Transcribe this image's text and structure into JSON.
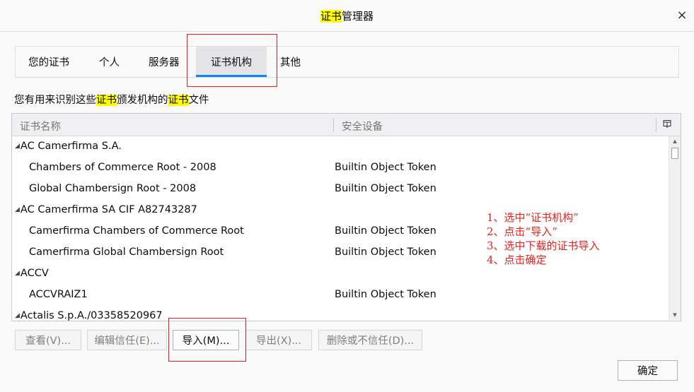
{
  "dialog": {
    "title_highlight": "证书",
    "title_rest": "管理器",
    "close_glyph": "×"
  },
  "tabs": [
    {
      "label": "您的证书",
      "selected": false
    },
    {
      "label": "个人",
      "selected": false
    },
    {
      "label": "服务器",
      "selected": false
    },
    {
      "label": "证书机构",
      "selected": true
    },
    {
      "label": "其他",
      "selected": false
    }
  ],
  "description": {
    "part1": "您有用来识别这些",
    "hl1": "证书",
    "part2": "颁发机构的",
    "hl2": "证书",
    "part3": "文件"
  },
  "table": {
    "columns": [
      "证书名称",
      "安全设备"
    ],
    "picker_icon": "column-picker-icon",
    "rows": [
      {
        "type": "group",
        "name": "AC Camerfirma S.A.",
        "token": ""
      },
      {
        "type": "child",
        "name": "Chambers of Commerce Root - 2008",
        "token": "Builtin Object Token"
      },
      {
        "type": "child",
        "name": "Global Chambersign Root - 2008",
        "token": "Builtin Object Token"
      },
      {
        "type": "group",
        "name": "AC Camerfirma SA CIF A82743287",
        "token": ""
      },
      {
        "type": "child",
        "name": "Camerfirma Chambers of Commerce Root",
        "token": "Builtin Object Token"
      },
      {
        "type": "child",
        "name": "Camerfirma Global Chambersign Root",
        "token": "Builtin Object Token"
      },
      {
        "type": "group",
        "name": "ACCV",
        "token": ""
      },
      {
        "type": "child",
        "name": "ACCVRAIZ1",
        "token": "Builtin Object Token"
      },
      {
        "type": "group",
        "name": "Actalis S.p.A./03358520967",
        "token": ""
      }
    ]
  },
  "buttons": {
    "view": "查看(V)...",
    "edit_trust": "编辑信任(E)...",
    "import": "导入(M)...",
    "export": "导出(X)...",
    "delete": "删除或不信任(D)...",
    "ok": "确定"
  },
  "annotations": [
    "1、选中“证书机构”",
    "2、点击“导入”",
    "3、选中下载的证书导入",
    "4、点击确定"
  ],
  "colors": {
    "highlight": "#ffff00",
    "accent": "#0a84ff",
    "annotation_red": "#e8201c"
  }
}
